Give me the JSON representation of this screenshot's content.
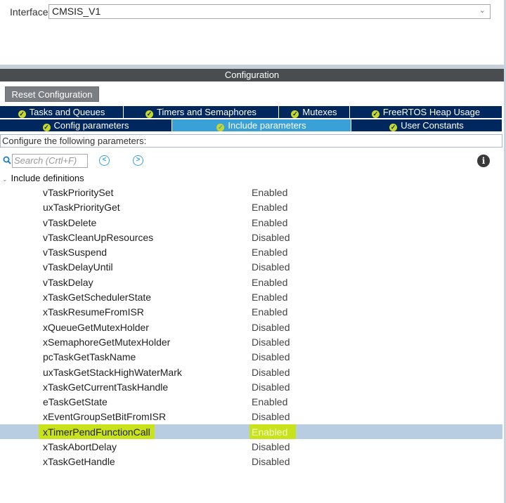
{
  "interface": {
    "label": "Interface",
    "value": "CMSIS_V1"
  },
  "config_title": "Configuration",
  "reset_button": "Reset Configuration",
  "tabs": {
    "row1": [
      {
        "label": "Tasks and Queues",
        "active": false
      },
      {
        "label": "Timers and Semaphores",
        "active": false
      },
      {
        "label": "Mutexes",
        "active": false
      },
      {
        "label": "FreeRTOS Heap Usage",
        "active": false
      }
    ],
    "row2": [
      {
        "label": "Config parameters",
        "active": false
      },
      {
        "label": "Include parameters",
        "active": true
      },
      {
        "label": "User Constants",
        "active": false
      }
    ]
  },
  "instruction": "Configure the following parameters:",
  "search": {
    "placeholder": "Search (Crtl+F)"
  },
  "group": {
    "label": "Include definitions"
  },
  "params": [
    {
      "name": "vTaskPrioritySet",
      "value": "Enabled"
    },
    {
      "name": "uxTaskPriorityGet",
      "value": "Enabled"
    },
    {
      "name": "vTaskDelete",
      "value": "Enabled"
    },
    {
      "name": "vTaskCleanUpResources",
      "value": "Disabled"
    },
    {
      "name": "vTaskSuspend",
      "value": "Enabled"
    },
    {
      "name": "vTaskDelayUntil",
      "value": "Disabled"
    },
    {
      "name": "vTaskDelay",
      "value": "Enabled"
    },
    {
      "name": "xTaskGetSchedulerState",
      "value": "Enabled"
    },
    {
      "name": "xTaskResumeFromISR",
      "value": "Enabled"
    },
    {
      "name": "xQueueGetMutexHolder",
      "value": "Disabled"
    },
    {
      "name": "xSemaphoreGetMutexHolder",
      "value": "Disabled"
    },
    {
      "name": "pcTaskGetTaskName",
      "value": "Disabled"
    },
    {
      "name": "uxTaskGetStackHighWaterMark",
      "value": "Disabled"
    },
    {
      "name": "xTaskGetCurrentTaskHandle",
      "value": "Disabled"
    },
    {
      "name": "eTaskGetState",
      "value": "Enabled"
    },
    {
      "name": "xEventGroupSetBitFromISR",
      "value": "Disabled"
    },
    {
      "name": "xTimerPendFunctionCall",
      "value": "Enabled",
      "selected": true
    },
    {
      "name": "xTaskAbortDelay",
      "value": "Disabled"
    },
    {
      "name": "xTaskGetHandle",
      "value": "Disabled"
    }
  ],
  "colors": {
    "tab_bg": "#00285e",
    "tab_active_bg": "#3aa0d8",
    "check_badge": "#c7d62a",
    "selection_row": "#b8cde2",
    "highlight": "#c8e21b"
  },
  "icons": {
    "search": "search-icon",
    "prev": "chevron-left-icon",
    "next": "chevron-right-icon",
    "info": "info-icon",
    "group_toggle": "chevron-down-icon",
    "tab_status": "check-circle-icon"
  }
}
